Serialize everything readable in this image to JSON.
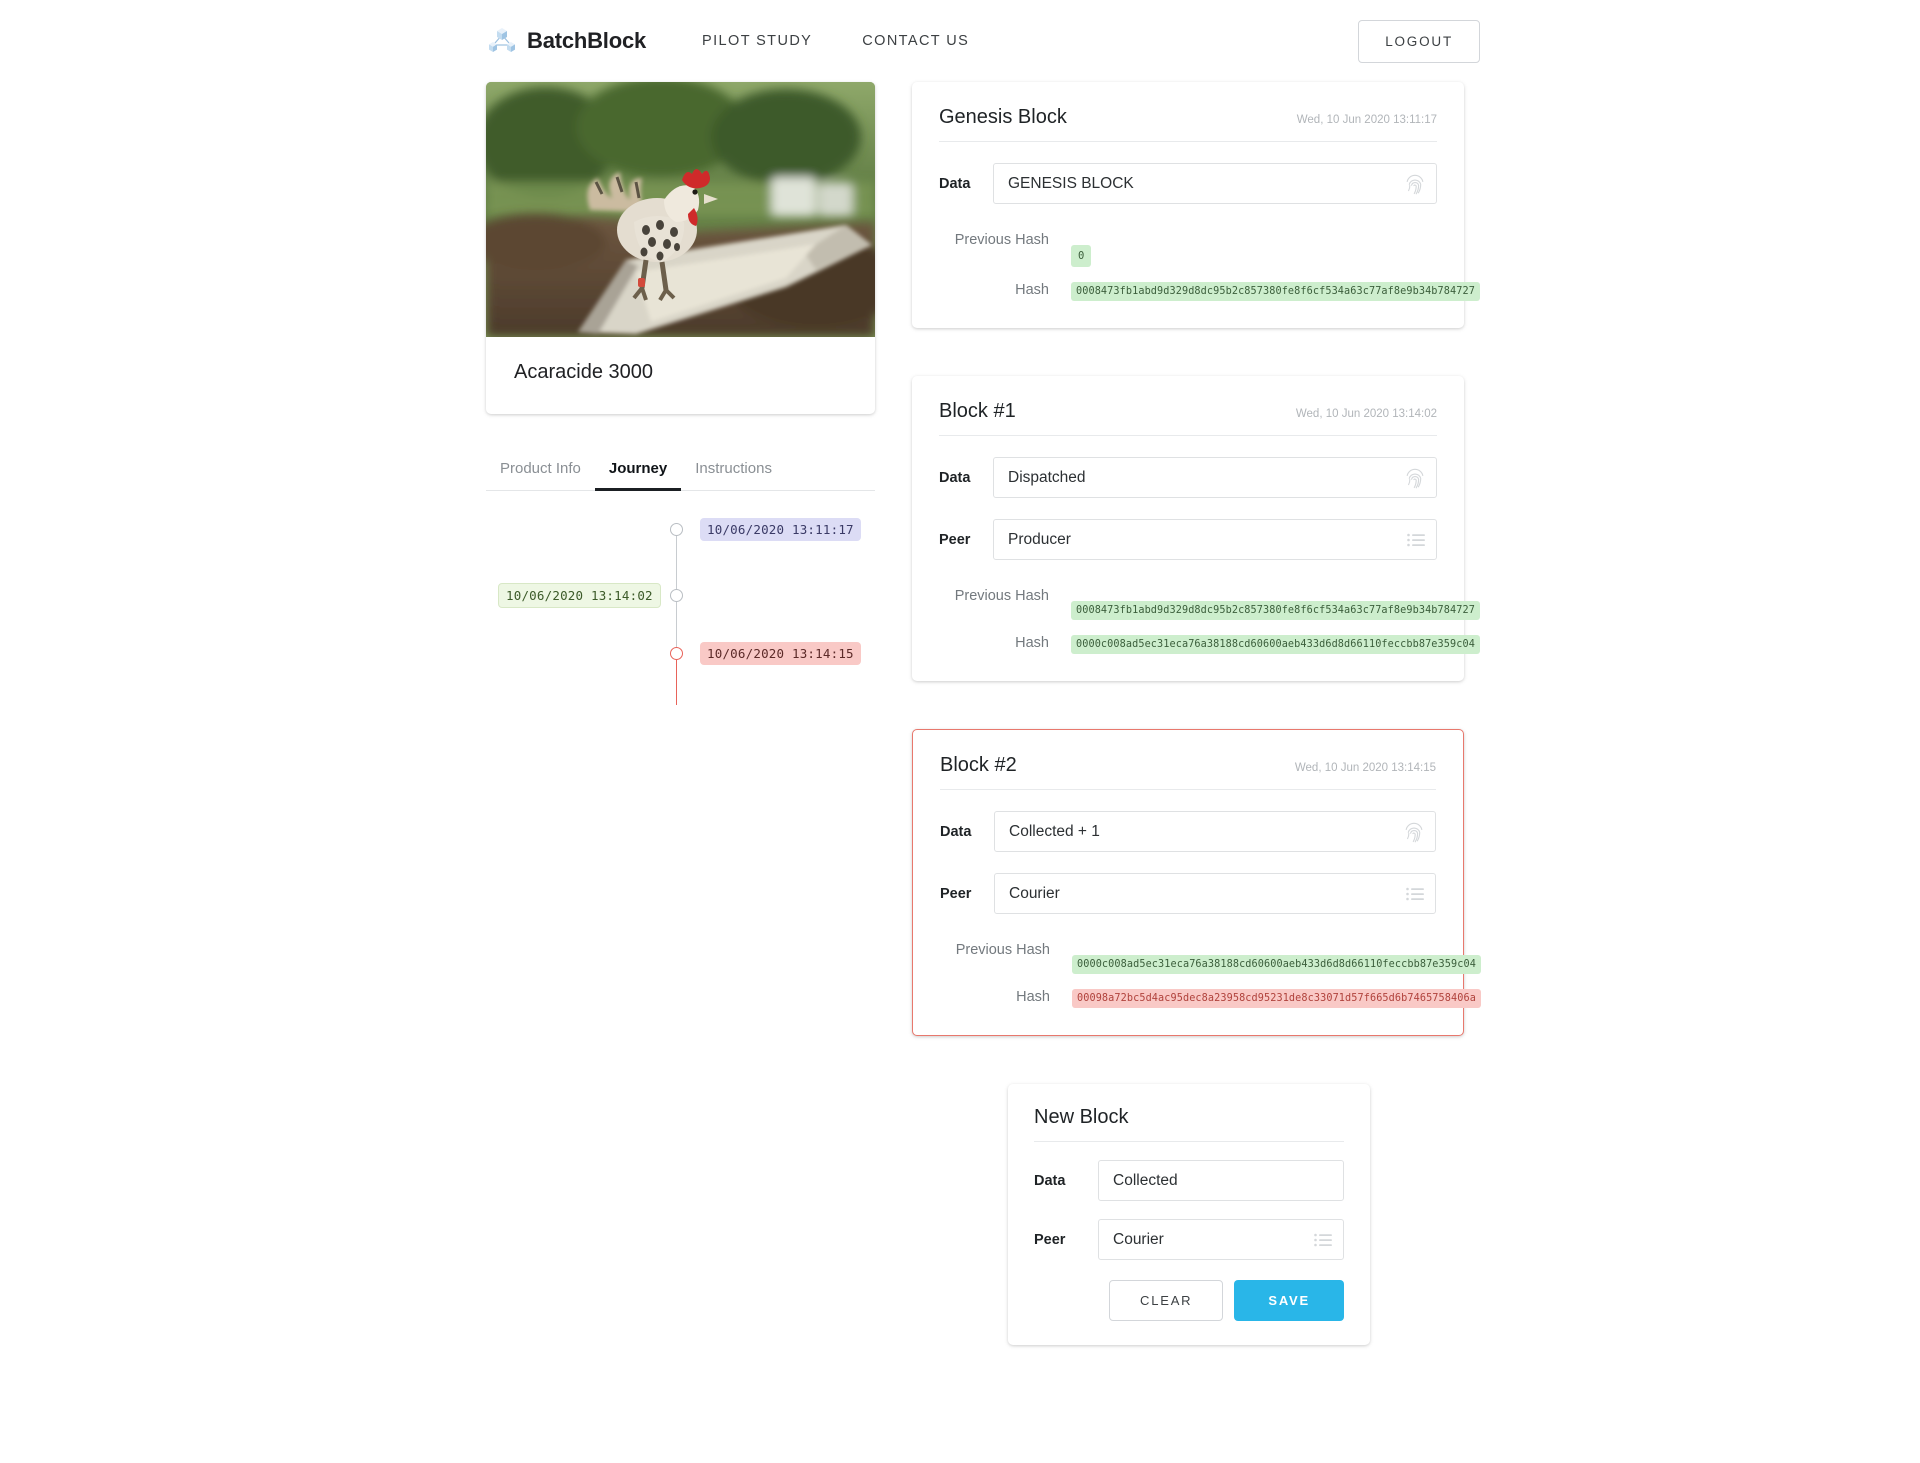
{
  "nav": {
    "brand": "BatchBlock",
    "brand_logo_icon": "cube-network-icon",
    "links": [
      {
        "label": "PILOT STUDY"
      },
      {
        "label": "CONTACT US"
      }
    ],
    "logout_label": "LOGOUT"
  },
  "product": {
    "title": "Acaracide 3000",
    "photo_alt": "rooster-standing-on-feeding-trough-photo"
  },
  "tabs": [
    {
      "label": "Product Info",
      "active": false
    },
    {
      "label": "Journey",
      "active": true
    },
    {
      "label": "Instructions",
      "active": false
    }
  ],
  "timeline": {
    "events": [
      {
        "label": "10/06/2020 13:11:17",
        "style": "blue",
        "side": "right"
      },
      {
        "label": "10/06/2020 13:14:02",
        "style": "green",
        "side": "left"
      },
      {
        "label": "10/06/2020 13:14:15",
        "style": "red",
        "side": "right"
      }
    ]
  },
  "blocks": [
    {
      "title": "Genesis Block",
      "timestamp": "Wed, 10 Jun 2020 13:11:17",
      "data_label": "Data",
      "data_value": "GENESIS BLOCK",
      "data_icon": "fingerprint-icon",
      "has_peer": false,
      "prev_hash_label": "Previous Hash",
      "prev_hash_value": "0",
      "prev_hash_style": "zero",
      "hash_label": "Hash",
      "hash_value": "0008473fb1abd9d329d8dc95b2c857380fe8f6cf534a63c77af8e9b34b784727",
      "hash_style": "green",
      "invalid": false
    },
    {
      "title": "Block #1",
      "timestamp": "Wed, 10 Jun 2020 13:14:02",
      "data_label": "Data",
      "data_value": "Dispatched",
      "data_icon": "fingerprint-icon",
      "has_peer": true,
      "peer_label": "Peer",
      "peer_value": "Producer",
      "peer_icon": "list-icon",
      "prev_hash_label": "Previous Hash",
      "prev_hash_value": "0008473fb1abd9d329d8dc95b2c857380fe8f6cf534a63c77af8e9b34b784727",
      "prev_hash_style": "green",
      "hash_label": "Hash",
      "hash_value": "0000c008ad5ec31eca76a38188cd60600aeb433d6d8d66110feccbb87e359c04",
      "hash_style": "green",
      "invalid": false
    },
    {
      "title": "Block #2",
      "timestamp": "Wed, 10 Jun 2020 13:14:15",
      "data_label": "Data",
      "data_value": "Collected + 1",
      "data_icon": "fingerprint-icon",
      "has_peer": true,
      "peer_label": "Peer",
      "peer_value": "Courier",
      "peer_icon": "list-icon",
      "prev_hash_label": "Previous Hash",
      "prev_hash_value": "0000c008ad5ec31eca76a38188cd60600aeb433d6d8d66110feccbb87e359c04",
      "prev_hash_style": "green",
      "hash_label": "Hash",
      "hash_value": "00098a72bc5d4ac95dec8a23958cd95231de8c33071d57f665d6b7465758406a",
      "hash_style": "red",
      "invalid": true
    }
  ],
  "new_block": {
    "title": "New Block",
    "data_label": "Data",
    "data_value": "Collected",
    "peer_label": "Peer",
    "peer_value": "Courier",
    "peer_icon": "list-icon",
    "clear_label": "CLEAR",
    "save_label": "SAVE"
  },
  "colors": {
    "accent": "#29b6e8",
    "valid_hash_bg": "#cdeecd",
    "invalid_hash_bg": "#f9c9c6",
    "invalid_border": "#e8786d",
    "timeline_blue": "#dcdcf5",
    "timeline_green": "#eef7e4",
    "timeline_red": "#f9c9c6"
  }
}
